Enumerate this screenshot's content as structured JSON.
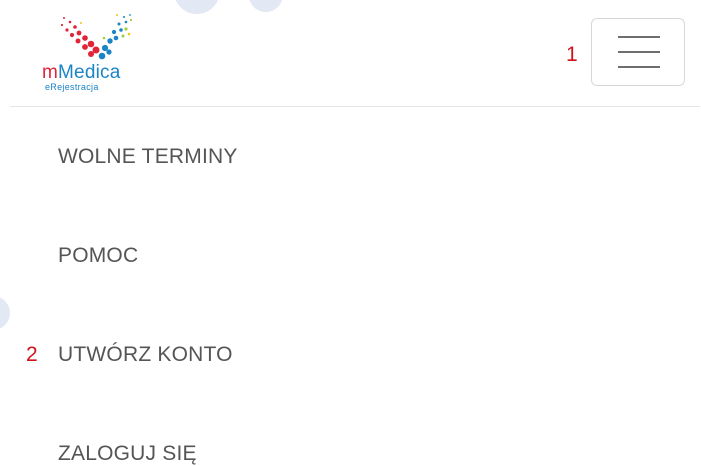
{
  "header": {
    "logo": {
      "brand_prefix": "m",
      "brand_name": "Medica",
      "tagline": "eRejestracja"
    },
    "menu_toggle_icon": "hamburger-menu-icon",
    "callout_number": "1"
  },
  "nav": {
    "items": [
      {
        "label": "WOLNE TERMINY"
      },
      {
        "label": "POMOC"
      },
      {
        "label": "UTWÓRZ KONTO",
        "callout": "2"
      },
      {
        "label": "ZALOGUJ SIĘ"
      }
    ]
  },
  "colors": {
    "brand_red": "#e02439",
    "brand_blue": "#1b84c5",
    "menu_text": "#555555",
    "callout_red": "#d0121b",
    "watermark": "#e3e9f4"
  }
}
